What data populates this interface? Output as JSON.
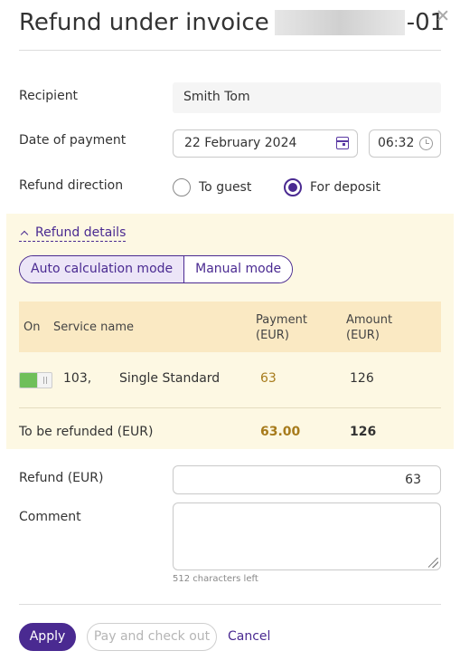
{
  "dialog": {
    "title_prefix": "Refund under invoice",
    "title_suffix": "-01"
  },
  "form": {
    "recipient_label": "Recipient",
    "recipient_value": "Smith Tom",
    "date_label": "Date of payment",
    "date_value": "22 February 2024",
    "time_value": "06:32",
    "direction_label": "Refund direction",
    "direction_options": [
      {
        "label": "To guest",
        "selected": false
      },
      {
        "label": "For deposit",
        "selected": true
      }
    ]
  },
  "details": {
    "toggle_label": "Refund details",
    "modes": [
      {
        "label": "Auto calculation mode",
        "active": true
      },
      {
        "label": "Manual mode",
        "active": false
      }
    ],
    "table": {
      "headers": {
        "on": "On",
        "service": "Service name",
        "payment_line1": "Payment",
        "payment_line2": "(EUR)",
        "amount_line1": "Amount",
        "amount_line2": "(EUR)"
      },
      "rows": [
        {
          "enabled": true,
          "room": "103,",
          "service": "Single Standard",
          "payment": "63",
          "amount": "126"
        }
      ],
      "total": {
        "label": "To be refunded (EUR)",
        "payment": "63.00",
        "amount": "126"
      }
    }
  },
  "refund": {
    "label": "Refund (EUR)",
    "value": "63"
  },
  "comment": {
    "label": "Comment",
    "value": "",
    "chars_left": "512 characters left"
  },
  "actions": {
    "apply": "Apply",
    "pay_checkout": "Pay and check out",
    "cancel": "Cancel"
  },
  "colors": {
    "accent": "#4a2a91",
    "details_bg": "#fdf8e3",
    "table_header_bg": "#fae9c3",
    "payment_text": "#a77b1c",
    "toggle_on": "#6fbf5a"
  }
}
